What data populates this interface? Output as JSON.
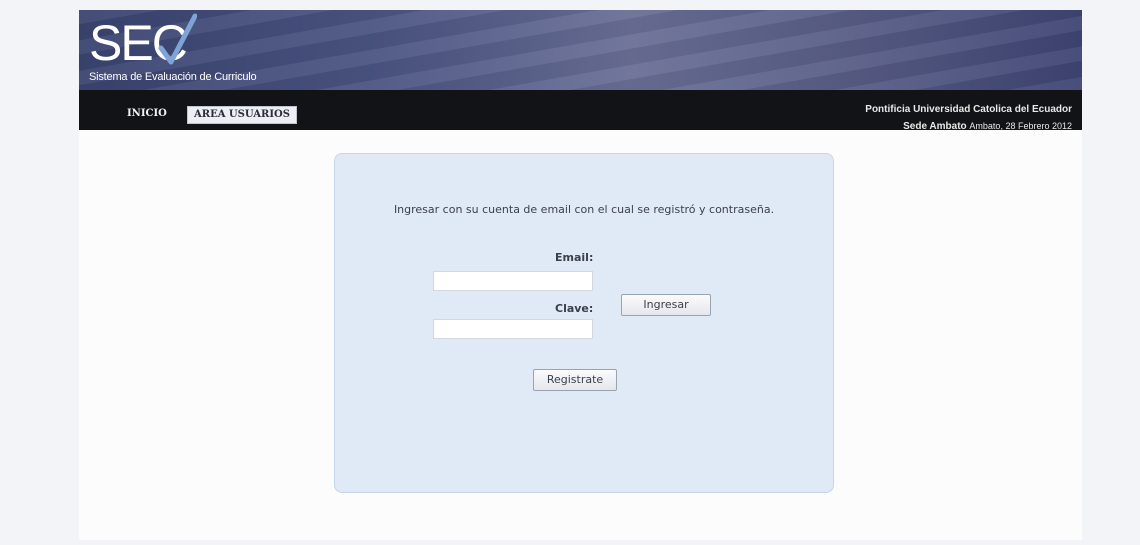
{
  "header": {
    "logo_text": "SEC",
    "logo_subtitle": "Sistema de Evaluación de Curriculo",
    "institution": "Pontificia Universidad Catolica del Ecuador",
    "campus": "Sede Ambato",
    "date": "Ambato, 28 Febrero 2012"
  },
  "nav": {
    "items": [
      {
        "label": "INICIO"
      },
      {
        "label": "AREA USUARIOS"
      }
    ]
  },
  "login": {
    "instruction": "Ingresar con su cuenta de email con el cual se registró y contraseña.",
    "email_label": "Email:",
    "email_value": "",
    "clave_label": "Clave:",
    "clave_value": "",
    "submit_label": "Ingresar",
    "register_label": "Registrate"
  },
  "colors": {
    "banner": "#4b5583",
    "navbar": "#121317",
    "panel": "#e0eaf7"
  }
}
